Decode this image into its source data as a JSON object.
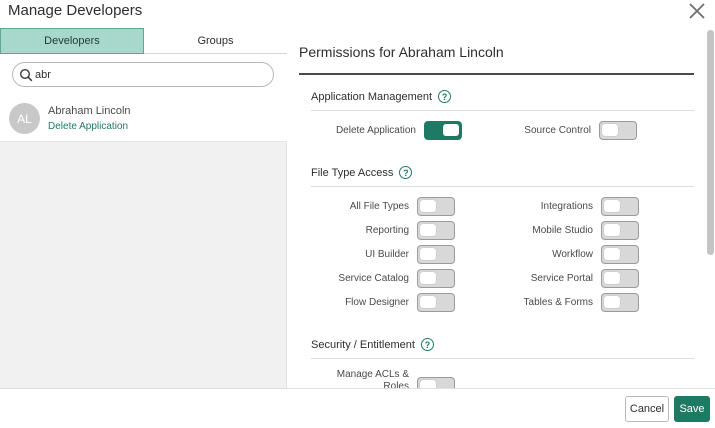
{
  "modal": {
    "title": "Manage Developers",
    "close_icon": "close-icon"
  },
  "tabs": [
    {
      "label": "Developers",
      "active": true
    },
    {
      "label": "Groups",
      "active": false
    }
  ],
  "search": {
    "value": "abr",
    "icon": "search-icon"
  },
  "users": [
    {
      "initials": "AL",
      "name": "Abraham Lincoln",
      "permission": "Delete Application"
    }
  ],
  "permissions": {
    "title": "Permissions for Abraham Lincoln",
    "sections": [
      {
        "title": "Application Management",
        "items": [
          {
            "label": "Delete Application",
            "on": true
          },
          {
            "label": "Source Control",
            "on": false
          }
        ]
      },
      {
        "title": "File Type Access",
        "items": [
          {
            "label": "All File Types",
            "on": false
          },
          {
            "label": "Integrations",
            "on": false
          },
          {
            "label": "Reporting",
            "on": false
          },
          {
            "label": "Mobile Studio",
            "on": false
          },
          {
            "label": "UI Builder",
            "on": false
          },
          {
            "label": "Workflow",
            "on": false
          },
          {
            "label": "Service Catalog",
            "on": false
          },
          {
            "label": "Service Portal",
            "on": false
          },
          {
            "label": "Flow Designer",
            "on": false
          },
          {
            "label": "Tables & Forms",
            "on": false
          }
        ]
      },
      {
        "title": "Security / Entitlement",
        "items": [
          {
            "label": "Manage ACLs & Roles",
            "on": false
          }
        ]
      }
    ]
  },
  "footer": {
    "cancel_label": "Cancel",
    "save_label": "Save"
  },
  "colors": {
    "accent": "#1f7a64",
    "tab_active_bg": "#a8d8cb",
    "toggle_off": "#d8d8d8"
  }
}
